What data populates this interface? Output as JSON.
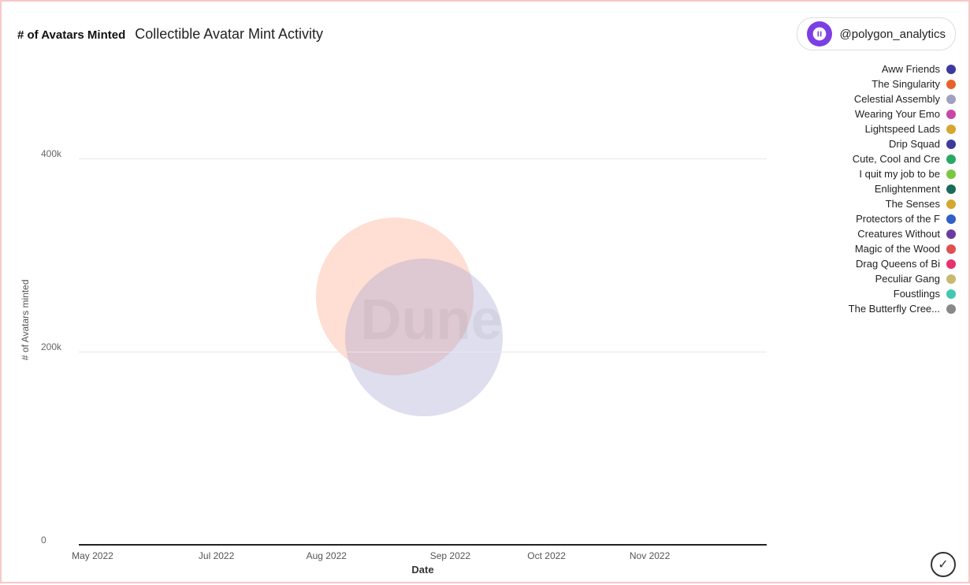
{
  "header": {
    "y_label": "# of Avatars Minted",
    "title": "Collectible Avatar Mint Activity",
    "polygon_handle": "@polygon_analytics"
  },
  "chart": {
    "y_axis_label": "# of Avatars minted",
    "x_axis_label": "Date",
    "y_ticks": [
      {
        "label": "400k",
        "percent": 80
      },
      {
        "label": "200k",
        "percent": 40
      },
      {
        "label": "0",
        "percent": 0
      }
    ],
    "x_ticks": [
      {
        "label": "May 2022",
        "pos": 2
      },
      {
        "label": "Jul 2022",
        "pos": 18
      },
      {
        "label": "Aug 2022",
        "pos": 33
      },
      {
        "label": "Sep 2022",
        "pos": 52
      },
      {
        "label": "Oct 2022",
        "pos": 66
      },
      {
        "label": "Nov 2022",
        "pos": 80
      }
    ],
    "dune_watermark": "Dune"
  },
  "legend": {
    "items": [
      {
        "label": "Aww Friends",
        "color": "#3b3b9e"
      },
      {
        "label": "The Singularity",
        "color": "#e8612a"
      },
      {
        "label": "Celestial Assembly",
        "color": "#a0a0c0"
      },
      {
        "label": "Wearing Your Emo",
        "color": "#c946a8"
      },
      {
        "label": "Lightspeed Lads",
        "color": "#d4a830"
      },
      {
        "label": "Drip Squad",
        "color": "#3b3b9e"
      },
      {
        "label": "Cute, Cool and Cre",
        "color": "#2aa866"
      },
      {
        "label": "I quit my job to be",
        "color": "#7bc742"
      },
      {
        "label": "Enlightenment",
        "color": "#1a6b5a"
      },
      {
        "label": "The Senses",
        "color": "#d4a830"
      },
      {
        "label": "Protectors of the F",
        "color": "#3060c8"
      },
      {
        "label": "Creatures Without",
        "color": "#6b3ca0"
      },
      {
        "label": "Magic of the Wood",
        "color": "#e05050"
      },
      {
        "label": "Drag Queens of Bi",
        "color": "#e83070"
      },
      {
        "label": "Peculiar Gang",
        "color": "#c8b870"
      },
      {
        "label": "Foustlings",
        "color": "#40c8b0"
      },
      {
        "label": "The Butterfly Cree...",
        "color": "#888888"
      }
    ],
    "check_icon": "✓"
  }
}
